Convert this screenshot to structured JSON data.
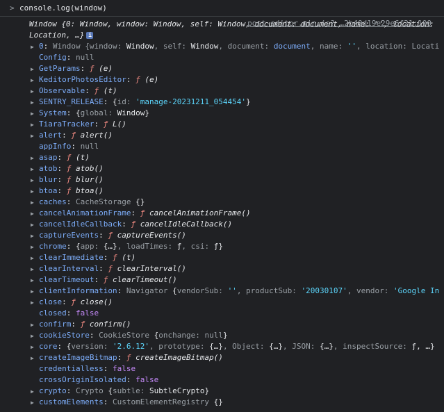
{
  "command": "console.log(window)",
  "source_link": "post-editor.min.js? …2b40d19e29e6f21:100",
  "summary": {
    "line1": "Window {0: Window, window: Window, self: Window, document: document, name: '', location:",
    "line2": "Location, …}",
    "info": "i"
  },
  "rows": [
    {
      "exp": true,
      "key": "0",
      "parts": [
        [
          "class",
          "Window {"
        ],
        [
          "pk",
          "window: "
        ],
        [
          "pv",
          "Window"
        ],
        [
          "pk",
          ", self: "
        ],
        [
          "pv",
          "Window"
        ],
        [
          "pk",
          ", document: "
        ],
        [
          "key",
          "document"
        ],
        [
          "pk",
          ", name: "
        ],
        [
          "pvs",
          "''"
        ],
        [
          "pk",
          ", location: Locati"
        ]
      ]
    },
    {
      "exp": false,
      "key": "Config",
      "parts": [
        [
          "null",
          "null"
        ]
      ]
    },
    {
      "exp": true,
      "key": "GetParams",
      "parts": [
        [
          "fsym",
          "ƒ "
        ],
        [
          "fn",
          "(e)"
        ]
      ]
    },
    {
      "exp": true,
      "key": "KeditorPhotosEditor",
      "parts": [
        [
          "fsym",
          "ƒ "
        ],
        [
          "fn",
          "(e)"
        ]
      ]
    },
    {
      "exp": true,
      "key": "Observable",
      "parts": [
        [
          "fsym",
          "ƒ "
        ],
        [
          "fn",
          "(t)"
        ]
      ]
    },
    {
      "exp": true,
      "key": "SENTRY_RELEASE",
      "parts": [
        [
          "pv",
          "{"
        ],
        [
          "pk",
          "id: "
        ],
        [
          "pvs",
          "'manage-20231211_054454'"
        ],
        [
          "pv",
          "}"
        ]
      ]
    },
    {
      "exp": true,
      "key": "System",
      "parts": [
        [
          "pv",
          "{"
        ],
        [
          "pk",
          "global: "
        ],
        [
          "pv",
          "Window}"
        ]
      ]
    },
    {
      "exp": true,
      "key": "TiaraTracker",
      "parts": [
        [
          "fsym",
          "ƒ "
        ],
        [
          "fn",
          "L()"
        ]
      ]
    },
    {
      "exp": true,
      "key": "alert",
      "parts": [
        [
          "fsym",
          "ƒ "
        ],
        [
          "fn",
          "alert()"
        ]
      ]
    },
    {
      "exp": false,
      "key": "appInfo",
      "parts": [
        [
          "null",
          "null"
        ]
      ]
    },
    {
      "exp": true,
      "key": "asap",
      "parts": [
        [
          "fsym",
          "ƒ "
        ],
        [
          "fn",
          "(t)"
        ]
      ]
    },
    {
      "exp": true,
      "key": "atob",
      "parts": [
        [
          "fsym",
          "ƒ "
        ],
        [
          "fn",
          "atob()"
        ]
      ]
    },
    {
      "exp": true,
      "key": "blur",
      "parts": [
        [
          "fsym",
          "ƒ "
        ],
        [
          "fn",
          "blur()"
        ]
      ]
    },
    {
      "exp": true,
      "key": "btoa",
      "parts": [
        [
          "fsym",
          "ƒ "
        ],
        [
          "fn",
          "btoa()"
        ]
      ]
    },
    {
      "exp": true,
      "key": "caches",
      "parts": [
        [
          "class",
          "CacheStorage "
        ],
        [
          "pv",
          "{}"
        ]
      ]
    },
    {
      "exp": true,
      "key": "cancelAnimationFrame",
      "parts": [
        [
          "fsym",
          "ƒ "
        ],
        [
          "fn",
          "cancelAnimationFrame()"
        ]
      ]
    },
    {
      "exp": true,
      "key": "cancelIdleCallback",
      "parts": [
        [
          "fsym",
          "ƒ "
        ],
        [
          "fn",
          "cancelIdleCallback()"
        ]
      ]
    },
    {
      "exp": true,
      "key": "captureEvents",
      "parts": [
        [
          "fsym",
          "ƒ "
        ],
        [
          "fn",
          "captureEvents()"
        ]
      ]
    },
    {
      "exp": true,
      "key": "chrome",
      "parts": [
        [
          "pv",
          "{"
        ],
        [
          "pk",
          "app: "
        ],
        [
          "pv",
          "{…}"
        ],
        [
          "pk",
          ", loadTimes: "
        ],
        [
          "pv",
          "ƒ"
        ],
        [
          "pk",
          ", csi: "
        ],
        [
          "pv",
          "ƒ}"
        ]
      ]
    },
    {
      "exp": true,
      "key": "clearImmediate",
      "parts": [
        [
          "fsym",
          "ƒ "
        ],
        [
          "fn",
          "(t)"
        ]
      ]
    },
    {
      "exp": true,
      "key": "clearInterval",
      "parts": [
        [
          "fsym",
          "ƒ "
        ],
        [
          "fn",
          "clearInterval()"
        ]
      ]
    },
    {
      "exp": true,
      "key": "clearTimeout",
      "parts": [
        [
          "fsym",
          "ƒ "
        ],
        [
          "fn",
          "clearTimeout()"
        ]
      ]
    },
    {
      "exp": true,
      "key": "clientInformation",
      "parts": [
        [
          "class",
          "Navigator "
        ],
        [
          "pv",
          "{"
        ],
        [
          "pk",
          "vendorSub: "
        ],
        [
          "pvs",
          "''"
        ],
        [
          "pk",
          ", productSub: "
        ],
        [
          "pvs",
          "'20030107'"
        ],
        [
          "pk",
          ", vendor: "
        ],
        [
          "pvs",
          "'Google In"
        ]
      ]
    },
    {
      "exp": true,
      "key": "close",
      "parts": [
        [
          "fsym",
          "ƒ "
        ],
        [
          "fn",
          "close()"
        ]
      ]
    },
    {
      "exp": false,
      "key": "closed",
      "parts": [
        [
          "bool",
          "false"
        ]
      ]
    },
    {
      "exp": true,
      "key": "confirm",
      "parts": [
        [
          "fsym",
          "ƒ "
        ],
        [
          "fn",
          "confirm()"
        ]
      ]
    },
    {
      "exp": true,
      "key": "cookieStore",
      "parts": [
        [
          "class",
          "CookieStore "
        ],
        [
          "pv",
          "{"
        ],
        [
          "pk",
          "onchange: "
        ],
        [
          "null",
          "null"
        ],
        [
          "pv",
          "}"
        ]
      ]
    },
    {
      "exp": true,
      "key": "core",
      "parts": [
        [
          "pv",
          "{"
        ],
        [
          "pk",
          "version: "
        ],
        [
          "pvs",
          "'2.6.12'"
        ],
        [
          "pk",
          ", prototype: "
        ],
        [
          "pv",
          "{…}"
        ],
        [
          "pk",
          ", Object: "
        ],
        [
          "pv",
          "{…}"
        ],
        [
          "pk",
          ", JSON: "
        ],
        [
          "pv",
          "{…}"
        ],
        [
          "pk",
          ", inspectSource: "
        ],
        [
          "pv",
          "ƒ, …}"
        ]
      ]
    },
    {
      "exp": true,
      "key": "createImageBitmap",
      "parts": [
        [
          "fsym",
          "ƒ "
        ],
        [
          "fn",
          "createImageBitmap()"
        ]
      ]
    },
    {
      "exp": false,
      "key": "credentialless",
      "parts": [
        [
          "bool",
          "false"
        ]
      ]
    },
    {
      "exp": false,
      "key": "crossOriginIsolated",
      "parts": [
        [
          "bool",
          "false"
        ]
      ]
    },
    {
      "exp": true,
      "key": "crypto",
      "parts": [
        [
          "class",
          "Crypto "
        ],
        [
          "pv",
          "{"
        ],
        [
          "pk",
          "subtle: "
        ],
        [
          "pv",
          "SubtleCrypto}"
        ]
      ]
    },
    {
      "exp": true,
      "key": "customElements",
      "parts": [
        [
          "class",
          "CustomElementRegistry "
        ],
        [
          "pv",
          "{}"
        ]
      ]
    }
  ],
  "colors": {
    "background": "#202124",
    "key": "#7cacf8",
    "string": "#5cd5fb",
    "function_symbol": "#f28b82",
    "boolean": "#c58af9"
  },
  "icons": {
    "expand": "triangle-right-icon",
    "prompt": "chevron-right-icon",
    "info": "info-icon"
  }
}
